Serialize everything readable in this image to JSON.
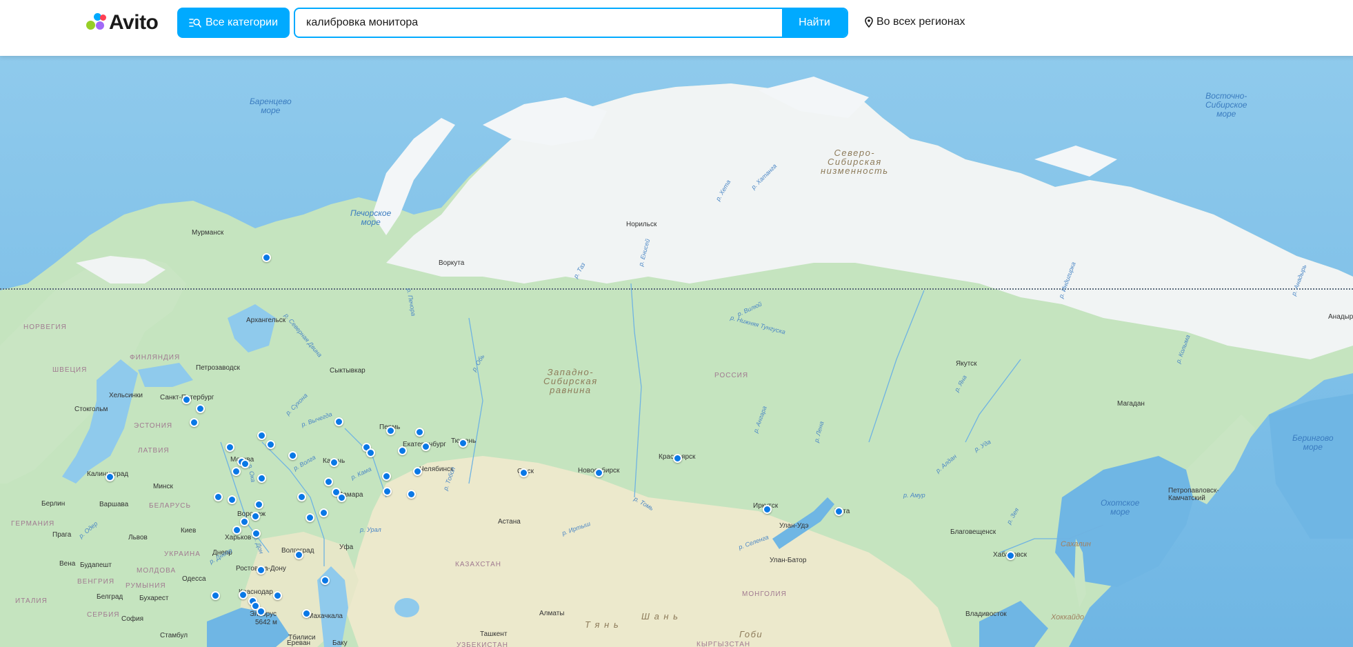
{
  "header": {
    "logo_text": "Avito",
    "categories_label": "Все категории",
    "search": {
      "value": "калибровка монитора",
      "button_label": "Найти"
    },
    "region_label": "Во всех регионах"
  },
  "colors": {
    "accent": "#00aaff",
    "marker": "#0a78e6",
    "sea": "#9ad0ee",
    "land": "#c7e6c2",
    "steppe": "#efeccf",
    "ice": "#f3f6f8"
  },
  "icons": {
    "categories": "search-list-icon",
    "region": "location-pin-icon"
  },
  "map": {
    "seas": [
      {
        "id": "barents",
        "text": "Баренцево\nморе"
      },
      {
        "id": "pechora",
        "text": "Печорское\nморе"
      },
      {
        "id": "east-siberian",
        "text": "Восточно-\nСибирское\nморе"
      },
      {
        "id": "bering",
        "text": "Берингово\nморе"
      },
      {
        "id": "okhotsk",
        "text": "Охотское\nморе"
      }
    ],
    "regions": [
      {
        "id": "north-siberian",
        "text": "Северо-\nСибирская\nнизменность"
      },
      {
        "id": "west-siberian",
        "text": "Западно-\nСибирская\nравнина"
      },
      {
        "id": "gobi",
        "text": "Гоби"
      },
      {
        "id": "tyan-shan",
        "text": "Т я н ь"
      },
      {
        "id": "shan",
        "text": "Ш а н ь"
      }
    ],
    "countries": [
      "НОРВЕГИЯ",
      "ФИНЛЯНДИЯ",
      "ШВЕЦИЯ",
      "ЭСТОНИЯ",
      "ЛАТВИЯ",
      "БЕЛАРУСЬ",
      "ГЕРМАНИЯ",
      "УКРАИНА",
      "МОЛДОВА",
      "ВЕНГРИЯ",
      "РУМЫНИЯ",
      "СЕРБИЯ",
      "ИТАЛИЯ",
      "КАЗАХСТАН",
      "МОНГОЛИЯ",
      "УЗБЕКИСТАН",
      "КЫРГЫЗСТАН",
      "РОССИЯ"
    ],
    "cities": [
      "Мурманск",
      "Архангельск",
      "Петрозаводск",
      "Санкт-Петербург",
      "Хельсинки",
      "Стокгольм",
      "Сыктывкар",
      "Воркута",
      "Норильск",
      "Якутск",
      "Магадан",
      "Анадырь",
      "Петропавловск-Камчатский",
      "Москва",
      "Казань",
      "Пермь",
      "Екатеринбург",
      "Тюмень",
      "Челябинск",
      "Омск",
      "Новосибирск",
      "Красноярск",
      "Иркутск",
      "Улан-Удэ",
      "Чита",
      "Улан-Батор",
      "Благовещенск",
      "Хабаровск",
      "Владивосток",
      "Хоккайдо",
      "Сахалин",
      "Калининград",
      "Минск",
      "Варшава",
      "Берлин",
      "Прага",
      "Вена",
      "Будапешт",
      "Белград",
      "Бухарест",
      "София",
      "Стамбул",
      "Киев",
      "Харьков",
      "Днепр",
      "Одесса",
      "Львов",
      "Воронеж",
      "Ростов-на-Дону",
      "Волгоград",
      "Краснодар",
      "Махачкала",
      "Тбилиси",
      "Ереван",
      "Баку",
      "Астана",
      "Алматы",
      "Ташкент",
      "Уфа",
      "Самара",
      "Эльбрус",
      "5642 м"
    ],
    "rivers": [
      "р. Печора",
      "р. Северная Двина",
      "р. Сухона",
      "р. Вычегда",
      "р. Кама",
      "р. Волга",
      "р. Ока",
      "р. Дон",
      "р. Урал",
      "р. Тобол",
      "р. Обь",
      "р. Иртыш",
      "р. Томь",
      "р. Енисей",
      "р. Нижняя Тунгуска",
      "р. Вилюй",
      "р. Лена",
      "р. Алдан",
      "р. Амур",
      "р. Селенга",
      "р. Хатанга",
      "р. Хета",
      "р. Таз",
      "р. Колыма",
      "р. Индигирка",
      "р. Анадырь",
      "р. Яна",
      "р. Уда",
      "р. Зея",
      "р. Ангара",
      "р. Одер",
      "р. Днепр"
    ]
  }
}
